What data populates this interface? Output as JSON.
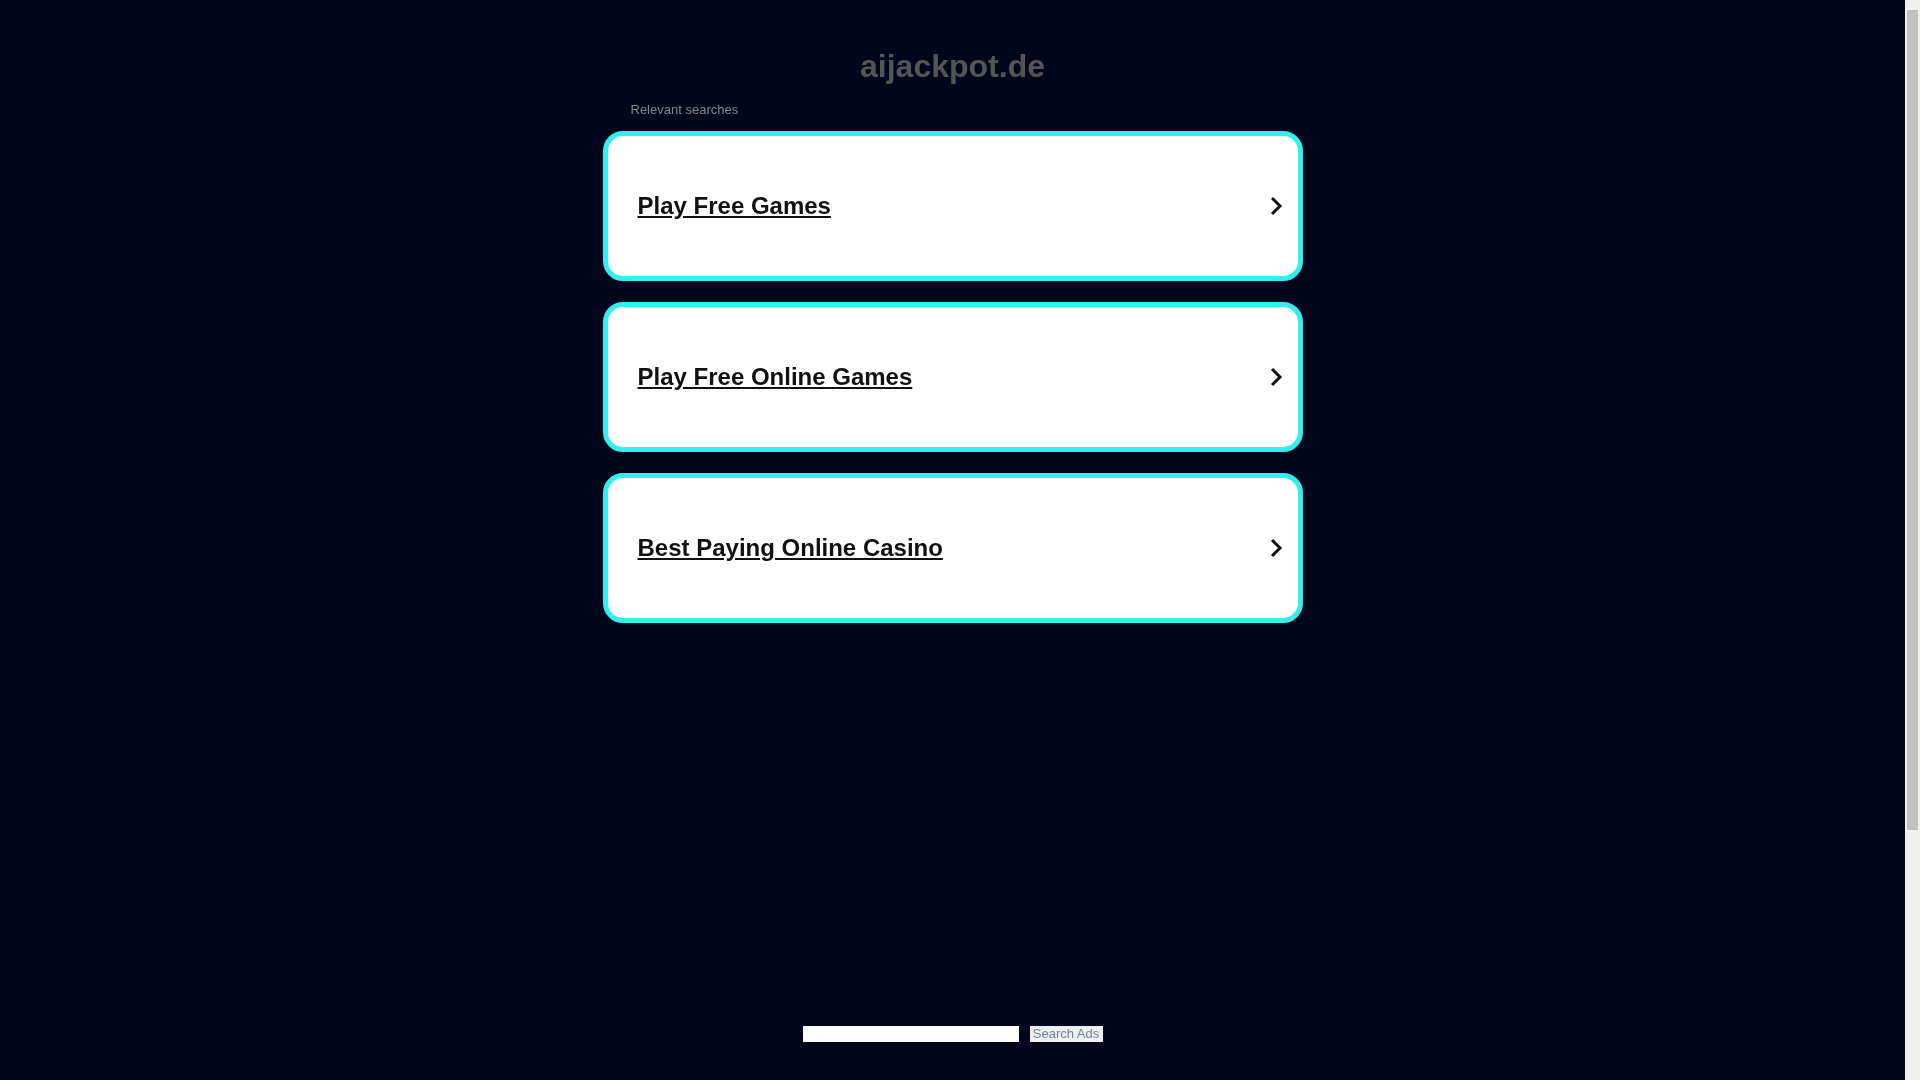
{
  "site_title": "aijackpot.de",
  "section_label": "Relevant searches",
  "results": [
    {
      "label": "Play Free Games"
    },
    {
      "label": "Play Free Online Games"
    },
    {
      "label": "Best Paying Online Casino"
    }
  ],
  "search": {
    "button": "Search Ads"
  }
}
